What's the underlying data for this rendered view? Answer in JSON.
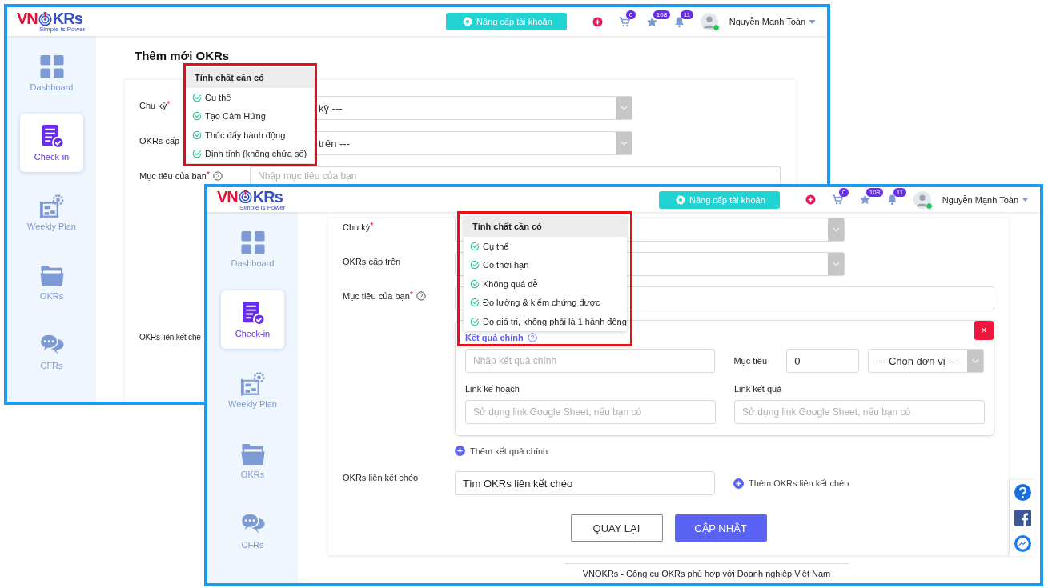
{
  "back_window": {
    "header": {
      "logo_left": "VN",
      "logo_right": "KRs",
      "tagline": "Simple is Power",
      "upgrade": "Nâng cấp tài khoản",
      "cart_count": "0",
      "star_count": "108",
      "bell_count": "11",
      "user": "Nguyễn Mạnh Toàn"
    },
    "sidebar": [
      {
        "kind": "dashboard",
        "label": "Dashboard",
        "selected": false
      },
      {
        "kind": "checkin",
        "label": "Check-in",
        "selected": true
      },
      {
        "kind": "weekly",
        "label": "Weekly Plan",
        "selected": false
      },
      {
        "kind": "okrs",
        "label": "OKRs",
        "selected": false
      },
      {
        "kind": "cfrs",
        "label": "CFRs",
        "selected": false
      }
    ],
    "title": "Thêm mới OKRs",
    "fields": [
      {
        "label": "Chu kỳ",
        "mark": "*",
        "kind": "select",
        "value": "kỳ ---"
      },
      {
        "label": "OKRs cấp",
        "kind": "select",
        "value": "trên ---"
      },
      {
        "label": "Mục tiêu của bạn",
        "mark": "*",
        "help": true,
        "kind": "input",
        "placeholder": "Nhập mục tiêu của bạn"
      }
    ],
    "cross_link_label": "OKRs liên kết ché",
    "popup": {
      "title": "Tính chất cần có",
      "items": [
        "Cụ thể",
        "Tạo Cảm Hứng",
        "Thúc đẩy hành động",
        "Định tính (không chứa số)"
      ]
    }
  },
  "front_window": {
    "header": {
      "logo_left": "VN",
      "logo_right": "KRs",
      "tagline": "Simple is Power",
      "upgrade": "Nâng cấp tài khoản",
      "cart_count": "0",
      "star_count": "108",
      "bell_count": "11",
      "user": "Nguyễn Mạnh Toàn"
    },
    "sidebar": [
      {
        "kind": "dashboard",
        "label": "Dashboard",
        "selected": false
      },
      {
        "kind": "checkin",
        "label": "Check-in",
        "selected": true
      },
      {
        "kind": "weekly",
        "label": "Weekly Plan",
        "selected": false
      },
      {
        "kind": "okrs",
        "label": "OKRs",
        "selected": false
      },
      {
        "kind": "cfrs",
        "label": "CFRs",
        "selected": false
      }
    ],
    "fields": [
      {
        "label": "Chu kỳ",
        "mark": "*",
        "kind": "select"
      },
      {
        "label": "OKRs cấp trên",
        "kind": "select"
      },
      {
        "label": "Mục tiêu của bạn",
        "mark": "*",
        "help": true,
        "kind": "input"
      }
    ],
    "key_result": {
      "title": "Kết quả chính",
      "remove": "×",
      "placeholder": "Nhập kết quả chính",
      "target_label": "Mục tiêu",
      "target_value": "0",
      "unit": "--- Chọn đơn vị ---",
      "plan_label": "Link kế hoạch",
      "plan_placeholder": "Sử dụng link Google Sheet, nếu bạn có",
      "result_label": "Link kết quả",
      "result_placeholder": "Sử dụng link Google Sheet, nếu bạn có"
    },
    "add_key_result": "Thêm kết quả chính",
    "cross_link": {
      "label": "OKRs liên kết chéo",
      "value": "Tìm OKRs liên kết chéo",
      "add": "Thêm OKRs liên kết chéo"
    },
    "buttons": [
      {
        "kind": "secondary",
        "label": "QUAY LẠI"
      },
      {
        "kind": "primary",
        "label": "CẬP NHẬT"
      }
    ],
    "footer": "VNOKRs - Công cụ OKRs phù hợp với Doanh nghiệp Việt Nam",
    "popup": {
      "title": "Tính chất cần có",
      "items": [
        "Cụ thể",
        "Có thời hạn",
        "Không quá dễ",
        "Đo lường & kiểm chứng được",
        "Đo giá trị, không phải là 1 hành động"
      ]
    }
  }
}
